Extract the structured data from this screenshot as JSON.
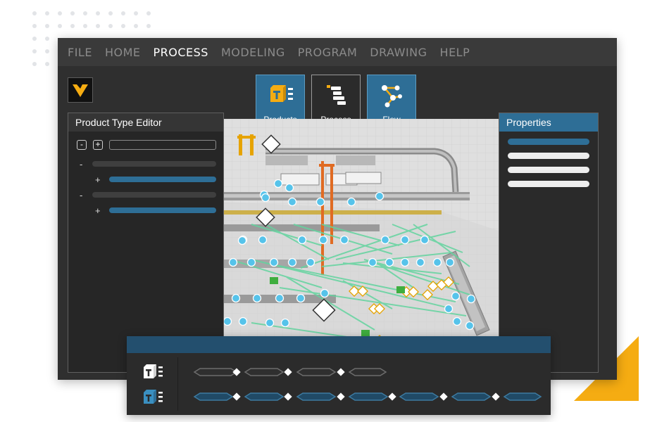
{
  "menu": {
    "items": [
      {
        "label": "FILE",
        "active": false
      },
      {
        "label": "HOME",
        "active": false
      },
      {
        "label": "PROCESS",
        "active": true
      },
      {
        "label": "MODELING",
        "active": false
      },
      {
        "label": "PROGRAM",
        "active": false
      },
      {
        "label": "DRAWING",
        "active": false
      },
      {
        "label": "HELP",
        "active": false
      }
    ]
  },
  "ribbon": {
    "products_label": "Products",
    "process_label": "Process",
    "flow_label": "Flow"
  },
  "left_panel": {
    "title": "Product Type Editor",
    "collapse_symbol": "-",
    "expand_symbol": "+"
  },
  "right_panel": {
    "title": "Properties"
  },
  "colors": {
    "accent_blue": "#2e6e96",
    "accent_yellow": "#f5ac12",
    "node_blue": "#56c3ea",
    "flow_green": "#63d49f",
    "timeline_header": "#234f6e"
  },
  "icons": {
    "logo": "visual-components-logo",
    "products": "products-icon",
    "process": "process-icon",
    "flow": "flow-icon"
  }
}
